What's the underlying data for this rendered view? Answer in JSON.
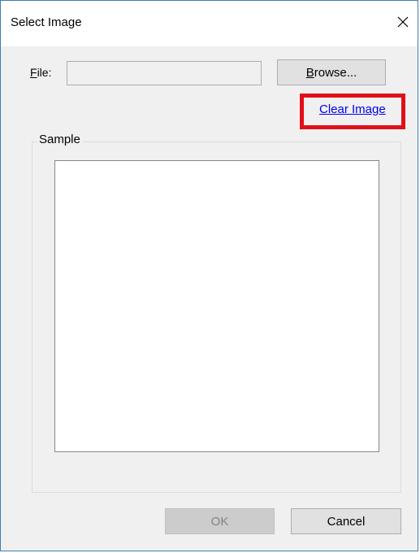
{
  "dialog": {
    "title": "Select Image",
    "close_icon": "close-icon"
  },
  "file": {
    "label_accel": "F",
    "label_rest": "ile:",
    "value": "",
    "placeholder": ""
  },
  "browse": {
    "label_accel": "B",
    "label_rest": "rowse..."
  },
  "clear_image": {
    "label": "Clear Image",
    "highlight_color": "#e01018"
  },
  "sample": {
    "legend": "Sample"
  },
  "footer": {
    "ok_label": "OK",
    "ok_enabled": false,
    "cancel_label": "Cancel"
  }
}
